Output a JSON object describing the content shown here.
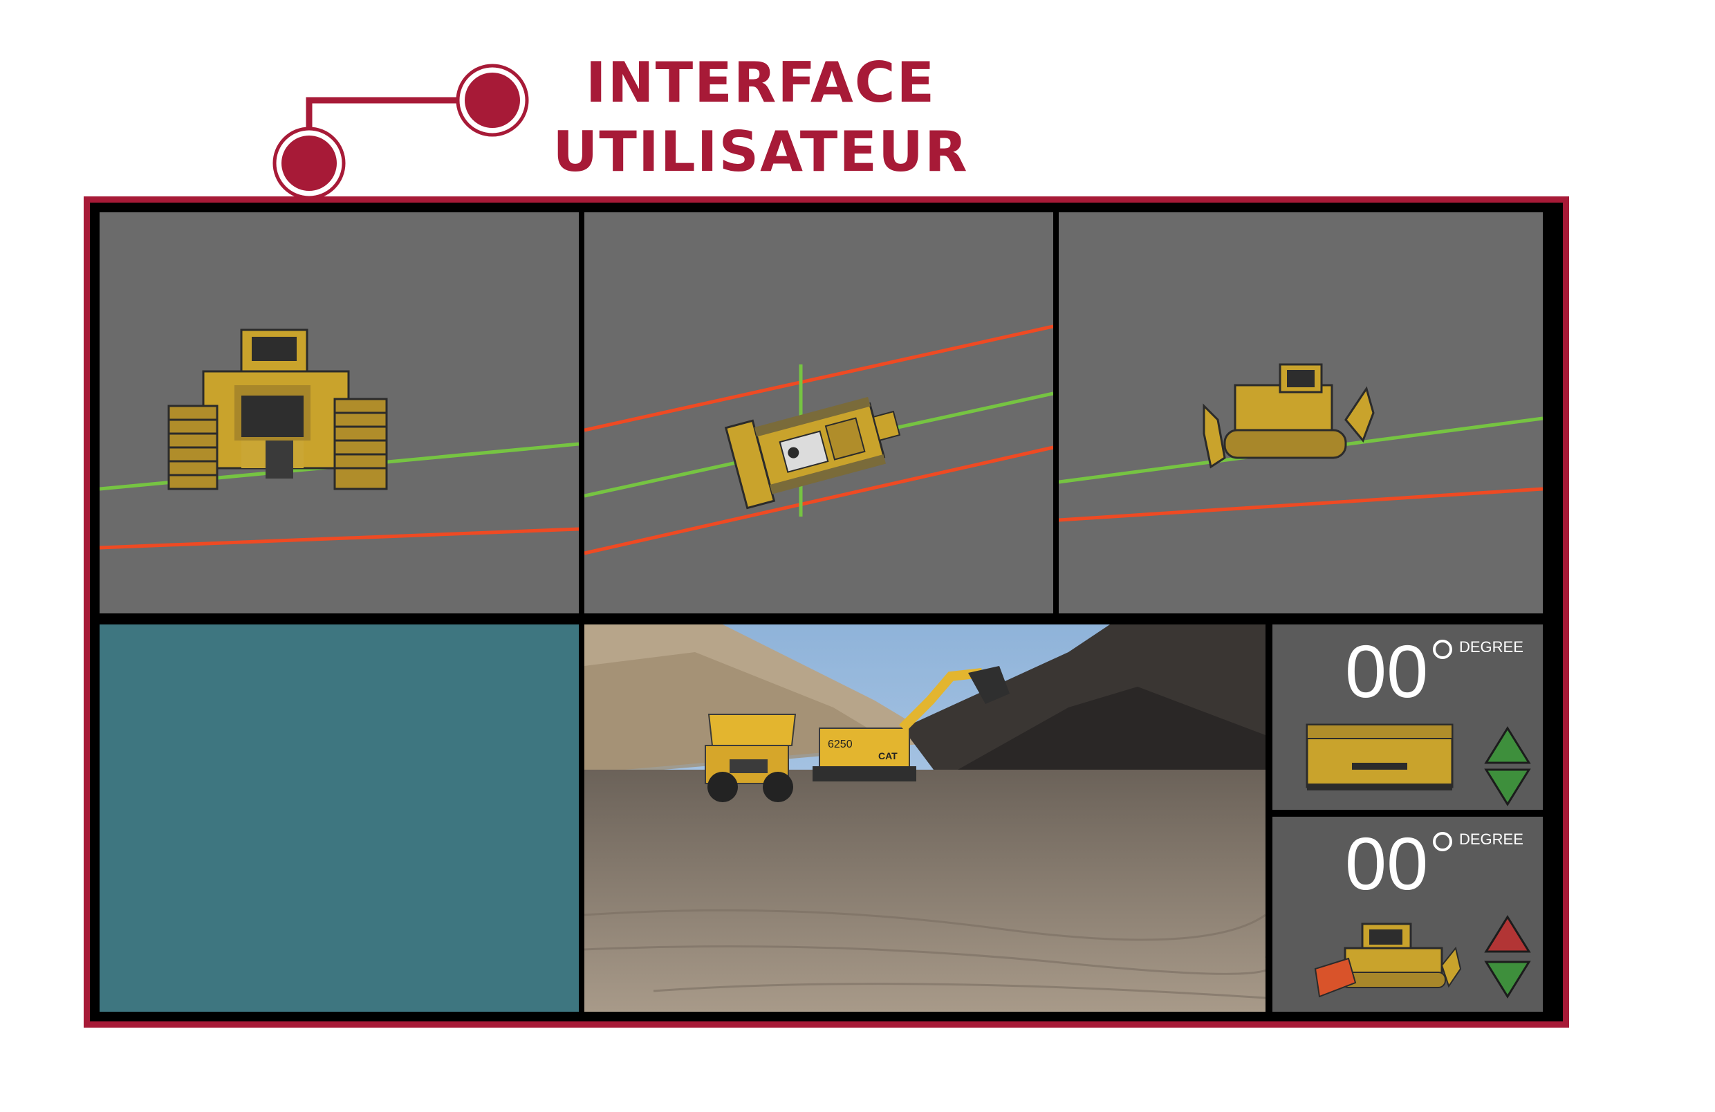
{
  "title": {
    "line1": "INTERFACE",
    "line2": "UTILISATEUR"
  },
  "colors": {
    "brand": "#a71a37",
    "view_background": "#6b6b6b",
    "guide_green": "#76c442",
    "guide_orange": "#ef4a23",
    "machine_yellow": "#c9a32c",
    "teal_panel": "#3e7680",
    "gauge_background": "#5b5b5b",
    "arrow_green": "#3e8f3c",
    "arrow_red": "#b23535"
  },
  "views": [
    {
      "name": "rear-view",
      "machine": "bulldozer-rear-icon"
    },
    {
      "name": "top-view",
      "machine": "bulldozer-top-icon"
    },
    {
      "name": "side-view",
      "machine": "bulldozer-side-icon"
    }
  ],
  "camera_feed": {
    "scene": "open-pit-mine-camera-image",
    "truck_marking": "",
    "excavator_marking": "6250",
    "excavator_brand": "CAT"
  },
  "gauges": {
    "blade_tilt": {
      "value": "00",
      "unit": "DEGREE",
      "icon": "blade-front-icon",
      "controls": [
        "arrow-up-icon",
        "arrow-down-icon"
      ]
    },
    "blade_lift": {
      "value": "00",
      "unit": "DEGREE",
      "icon": "bulldozer-blade-icon",
      "controls": [
        "arrow-up-icon",
        "arrow-down-icon"
      ]
    }
  }
}
